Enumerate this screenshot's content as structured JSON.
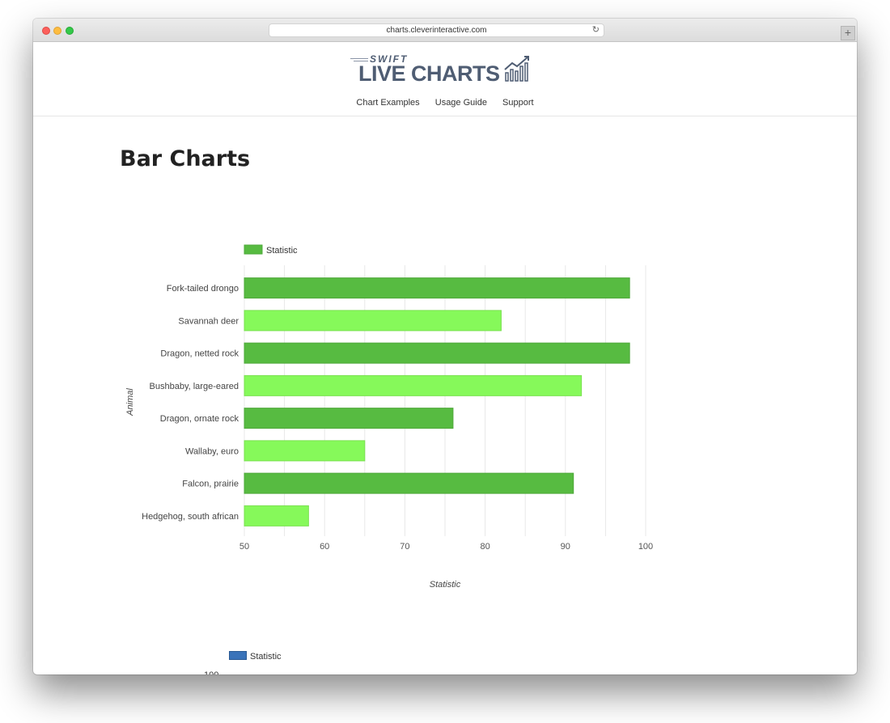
{
  "browser": {
    "url": "charts.cleverinteractive.com",
    "new_tab_label": "+"
  },
  "logo": {
    "top": "SWIFT",
    "main": "LIVE CHARTS"
  },
  "nav": {
    "items": [
      "Chart Examples",
      "Usage Guide",
      "Support"
    ]
  },
  "page": {
    "title": "Bar Charts"
  },
  "colors": {
    "dark_green": "#57bb41",
    "light_green": "#86f95a",
    "blue": "#3a73b9"
  },
  "chart_data": [
    {
      "type": "bar",
      "orientation": "horizontal",
      "categories": [
        "Fork-tailed drongo",
        "Savannah deer",
        "Dragon, netted rock",
        "Bushbaby, large-eared",
        "Dragon, ornate rock",
        "Wallaby, euro",
        "Falcon, prairie",
        "Hedgehog, south african"
      ],
      "series": [
        {
          "name": "Statistic",
          "values": [
            98,
            82,
            98,
            92,
            76,
            65,
            91,
            58
          ]
        }
      ],
      "xlabel": "Statistic",
      "ylabel": "Animal",
      "xlim": [
        50,
        100
      ],
      "xticks": [
        50,
        60,
        70,
        80,
        90,
        100
      ],
      "legend": "top-left",
      "grid": true
    },
    {
      "type": "bar",
      "series": [
        {
          "name": "Statistic"
        }
      ],
      "legend": "top-left",
      "visible_tick": "100"
    }
  ]
}
